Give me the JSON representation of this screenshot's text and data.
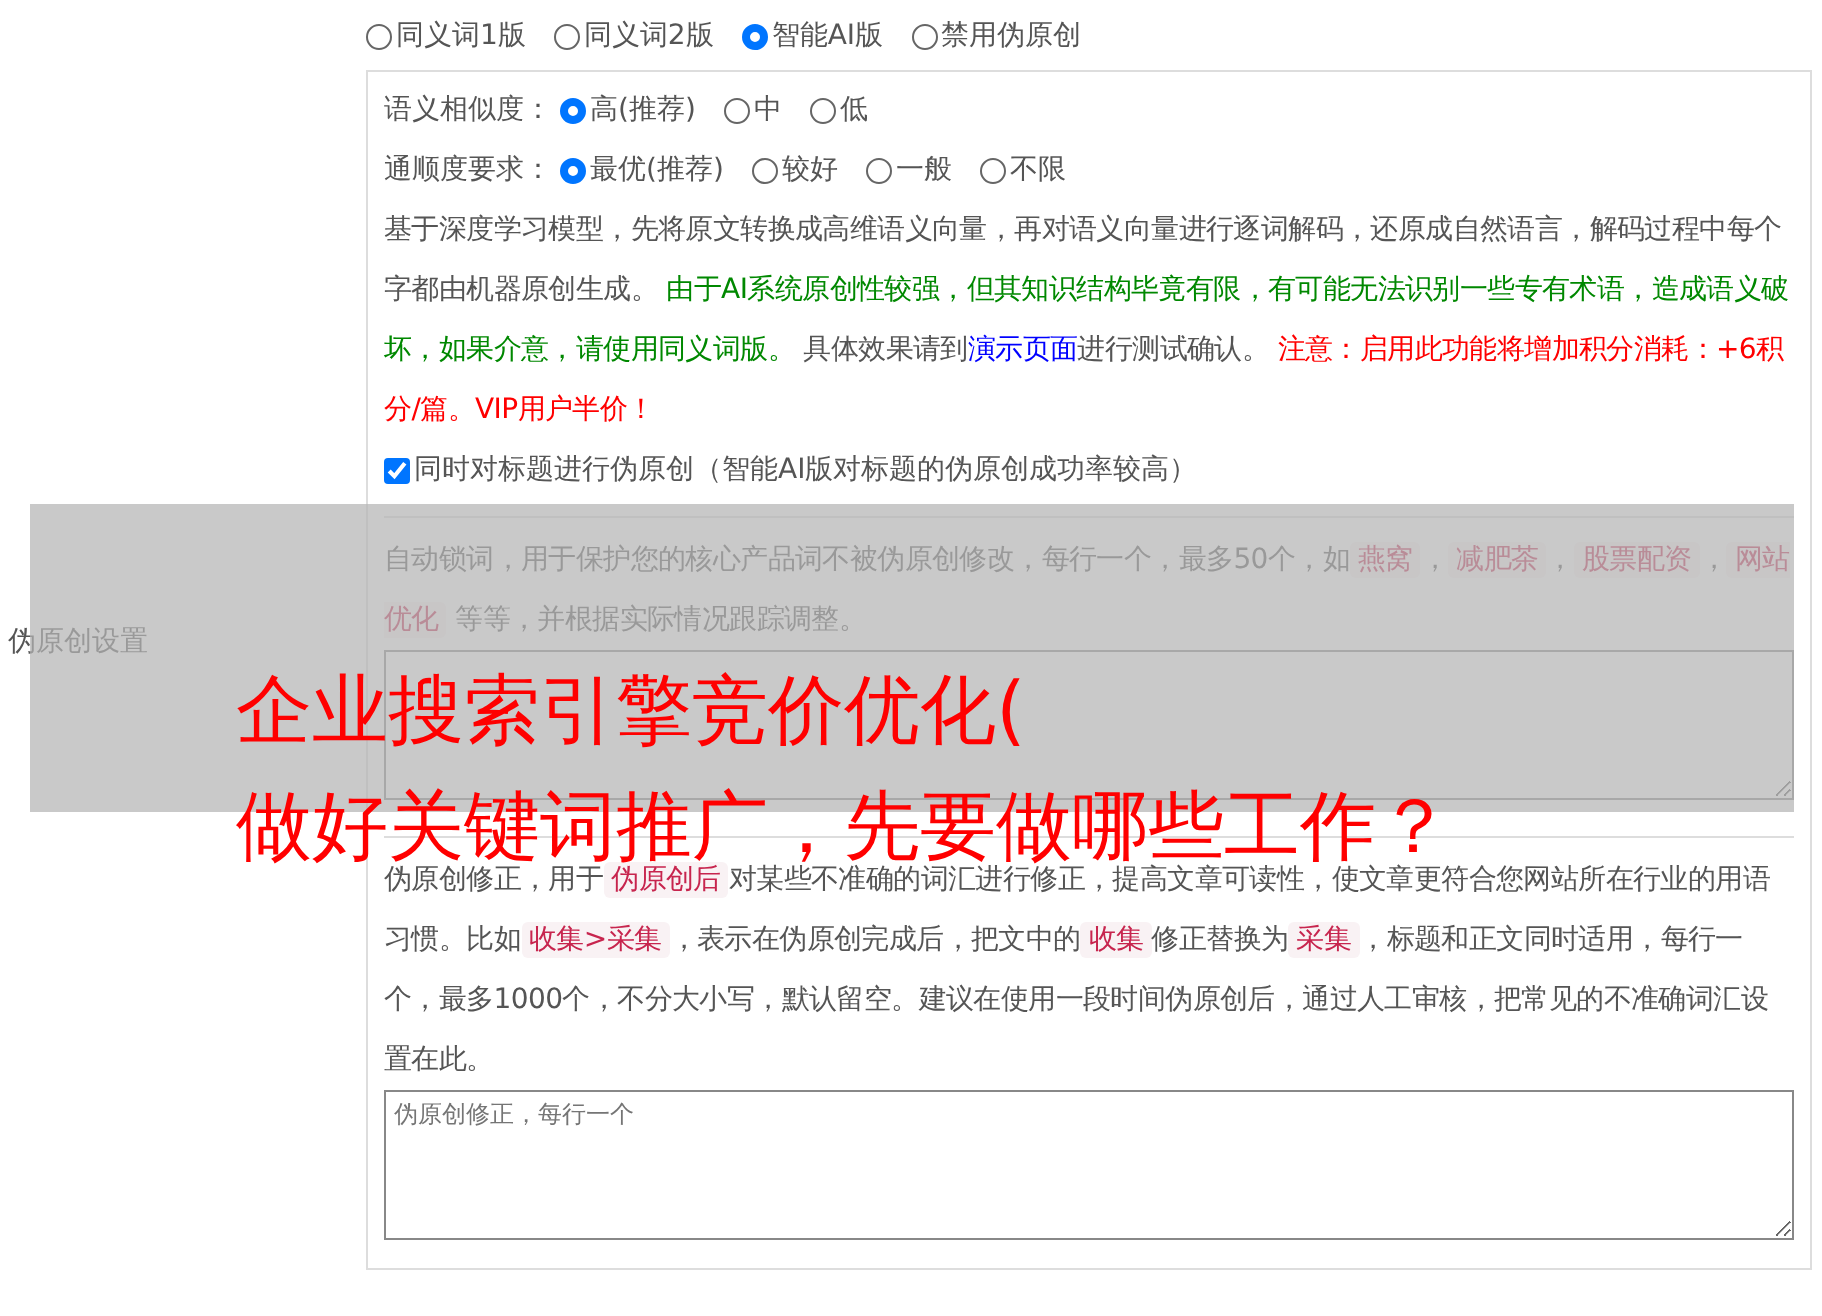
{
  "mode_options": [
    {
      "label": "同义词1版",
      "selected": false
    },
    {
      "label": "同义词2版",
      "selected": false
    },
    {
      "label": "智能AI版",
      "selected": true
    },
    {
      "label": "禁用伪原创",
      "selected": false
    }
  ],
  "similarity": {
    "label": "语义相似度：",
    "options": [
      {
        "label": "高(推荐)",
        "selected": true
      },
      {
        "label": "中",
        "selected": false
      },
      {
        "label": "低",
        "selected": false
      }
    ]
  },
  "fluency": {
    "label": "通顺度要求：",
    "options": [
      {
        "label": "最优(推荐)",
        "selected": true
      },
      {
        "label": "较好",
        "selected": false
      },
      {
        "label": "一般",
        "selected": false
      },
      {
        "label": "不限",
        "selected": false
      }
    ]
  },
  "ai_description": [
    {
      "kind": "plain",
      "text": "基于深度学习模型，先将原文转换成高维语义向量，再对语义向量进行逐词解码，还原成自然语言，解码过程中每个字都由机器原创生成。 "
    },
    {
      "kind": "note",
      "text": "由于AI系统原创性较强，但其知识结构毕竟有限，有可能无法识别一些专有术语，造成语义破坏，如果介意，请使用同义词版。"
    },
    {
      "kind": "plain",
      "text": " 具体效果请到"
    },
    {
      "kind": "link",
      "text": "演示页面"
    },
    {
      "kind": "plain",
      "text": "进行测试确认。 "
    },
    {
      "kind": "warning",
      "text": "注意：启用此功能将增加积分消耗：+6积分/篇。VIP用户半价！"
    }
  ],
  "title_checkbox": {
    "label": "同时对标题进行伪原创（智能AI版对标题的伪原创成功率较高）",
    "checked": true
  },
  "section_label": "伪原创设置",
  "lock_words": {
    "description": [
      {
        "kind": "plain",
        "text": "自动锁词，用于保护您的核心产品词不被伪原创修改，每行一个，最多50个，如"
      },
      {
        "kind": "tag",
        "text": "燕窝"
      },
      {
        "kind": "plain",
        "text": "，"
      },
      {
        "kind": "tag",
        "text": "减肥茶"
      },
      {
        "kind": "plain",
        "text": "，"
      },
      {
        "kind": "tag",
        "text": "股票配资"
      },
      {
        "kind": "plain",
        "text": "，"
      },
      {
        "kind": "tag",
        "text": "网站优化"
      },
      {
        "kind": "plain",
        "text": " 等等，并根据实际情况跟踪调整。"
      }
    ]
  },
  "corrections": {
    "description": [
      {
        "kind": "plain",
        "text": "伪原创修正，用于"
      },
      {
        "kind": "tag",
        "text": "伪原创后"
      },
      {
        "kind": "plain",
        "text": "对某些不准确的词汇进行修正，提高文章可读性，使文章更符合您网站所在行业的用语习惯。比如"
      },
      {
        "kind": "tag",
        "text": "收集>采集"
      },
      {
        "kind": "plain",
        "text": "，表示在伪原创完成后，把文中的"
      },
      {
        "kind": "tag",
        "text": "收集"
      },
      {
        "kind": "plain",
        "text": "修正替换为"
      },
      {
        "kind": "tag",
        "text": "采集"
      },
      {
        "kind": "plain",
        "text": "，标题和正文同时适用，每行一个，最多1000个，不分大小写，默认留空。建议在使用一段时间伪原创后，通过人工审核，把常见的不准确词汇设置在此。"
      }
    ],
    "placeholder": "伪原创修正，每行一个"
  },
  "overlay": {
    "lines": [
      "企业搜索引擎竞价优化(",
      "做好关键词推广，先要做哪些工作？"
    ]
  }
}
